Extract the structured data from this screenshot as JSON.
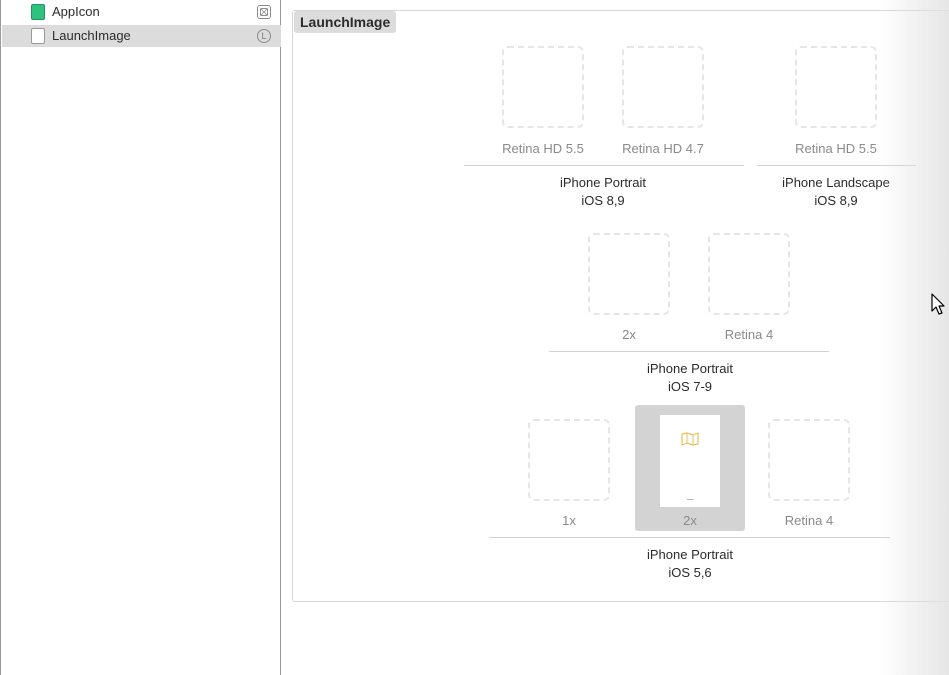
{
  "sidebar": {
    "items": [
      {
        "label": "AppIcon",
        "icon": "app-icon-set-icon",
        "badge_icon": "grid-badge-icon"
      },
      {
        "label": "LaunchImage",
        "icon": "launch-image-set-icon",
        "badge_icon": "launch-badge-icon",
        "badge_text": "L"
      }
    ]
  },
  "image_set": {
    "title": "LaunchImage",
    "groups": [
      {
        "line1": "iPhone Portrait",
        "line2": "iOS 8,9",
        "slots": [
          "Retina HD 5.5",
          "Retina HD 4.7"
        ]
      },
      {
        "line1": "iPhone Landscape",
        "line2": "iOS 8,9",
        "slots": [
          "Retina HD 5.5"
        ]
      },
      {
        "line1": "iPhone Portrait",
        "line2": "iOS 7-9",
        "slots": [
          "2x",
          "Retina 4"
        ]
      },
      {
        "line1": "iPhone Portrait",
        "line2": "iOS 5,6",
        "slots": [
          "1x",
          "2x",
          "Retina 4"
        ]
      }
    ]
  },
  "colors": {
    "accent_green": "#2ec27e",
    "selection_gray": "#dcdcdc",
    "thumb_icon": "#e8c25a"
  }
}
